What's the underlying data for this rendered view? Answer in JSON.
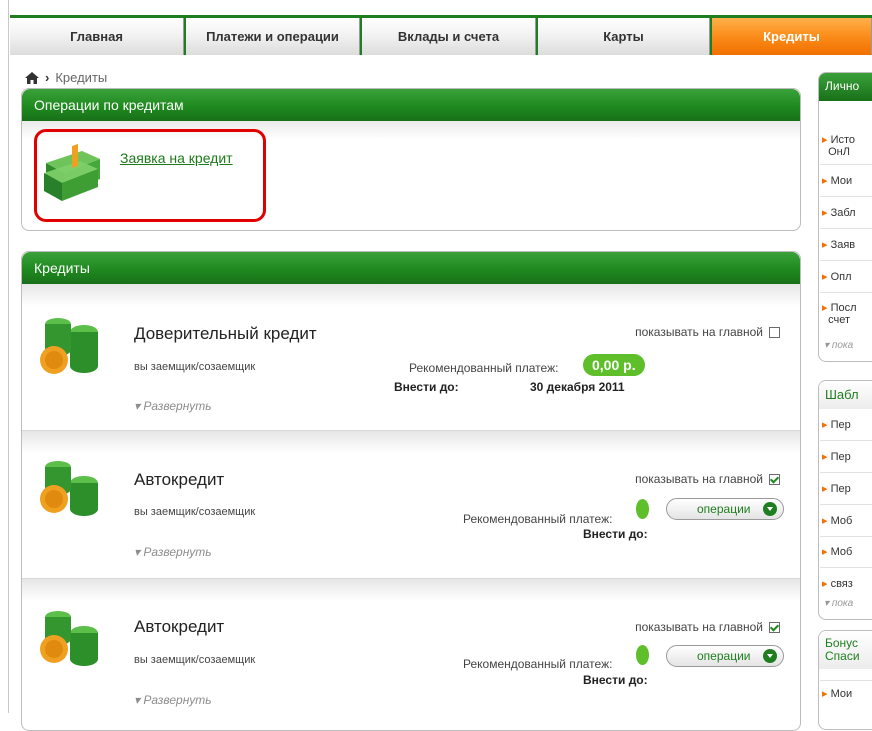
{
  "nav": {
    "tabs": [
      {
        "label": "Главная"
      },
      {
        "label": "Платежи и операции"
      },
      {
        "label": "Вклады и счета"
      },
      {
        "label": "Карты"
      },
      {
        "label": "Кредиты"
      }
    ],
    "active_tab": "Кредиты"
  },
  "breadcrumb": {
    "current": "Кредиты"
  },
  "operations_panel": {
    "title": "Операции по кредитам",
    "loan_application_link": "Заявка на кредит"
  },
  "credits_panel": {
    "title": "Кредиты",
    "items": [
      {
        "title": "Доверительный кредит",
        "role": "вы заемщик/созаемщик",
        "show_on_main_label": "показывать на главной",
        "show_on_main": false,
        "recommended_payment_label": "Рекомендованный платеж:",
        "recommended_payment_value": "0,00 р.",
        "due_label": "Внести до:",
        "due_date": "30 декабря 2011",
        "expand_label": "Развернуть"
      },
      {
        "title": "Автокредит",
        "role": "вы заемщик/созаемщик",
        "show_on_main_label": "показывать на главной",
        "show_on_main": true,
        "recommended_payment_label": "Рекомендованный платеж:",
        "due_label": "Внести до:",
        "operations_button": "операции",
        "expand_label": "Развернуть"
      },
      {
        "title": "Автокредит",
        "role": "вы заемщик/созаемщик",
        "show_on_main_label": "показывать на главной",
        "show_on_main": true,
        "recommended_payment_label": "Рекомендованный платеж:",
        "due_label": "Внести до:",
        "operations_button": "операции",
        "expand_label": "Развернуть"
      }
    ]
  },
  "right_column": {
    "personal": {
      "title": "Лично",
      "links": [
        "Исто ОнЛ",
        "Мои",
        "Забл",
        "Заяв",
        "Опл",
        "Посл счет"
      ],
      "more": "пока"
    },
    "templates": {
      "title": "Шабл",
      "links": [
        "Пер",
        "Пер",
        "Пер",
        "Моб",
        "Моб",
        "связ"
      ],
      "more": "пока"
    },
    "bonus": {
      "title": "Бонус Спаси",
      "links": [
        "Мои"
      ]
    }
  },
  "colors": {
    "brand_green": "#1f8a1f",
    "active_tab_orange": "#fb8c1a",
    "highlight_red": "#e00000",
    "payment_badge_green": "#5fbf2a"
  }
}
